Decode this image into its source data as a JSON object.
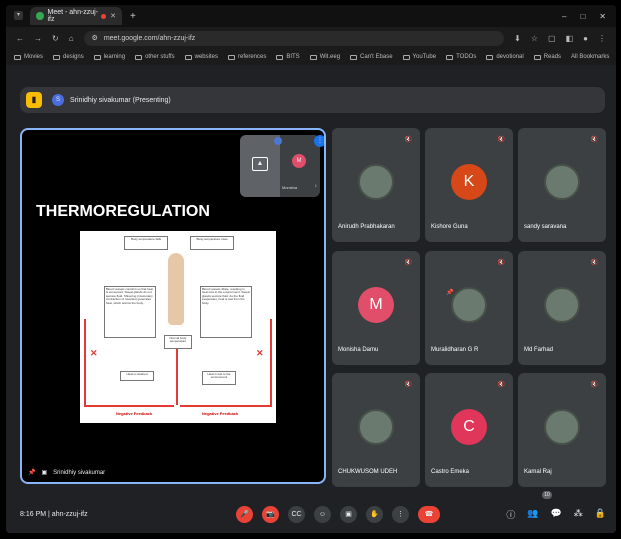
{
  "browser": {
    "tab_title": "Meet - ahn-zzuj-ifz",
    "url": "meet.google.com/ahn-zzuj-ifz",
    "bookmarks": [
      "Movies",
      "designs",
      "learning",
      "other stuffs",
      "websites",
      "references",
      "BITS",
      "Wit.eeg",
      "Can't Ebase",
      "YouTube",
      "TODOs",
      "devotional",
      "Reads"
    ],
    "all_bookmarks": "All Bookmarks"
  },
  "presenting": {
    "avatar": "S",
    "label": "Srinidhiy sivakumar (Presenting)"
  },
  "stage": {
    "slide_title": "THERMOREGULATION",
    "presenter": "Srinidhiy sivakumar",
    "pip_name": "Monisha",
    "pip_avatar": "M",
    "diagram": {
      "top_left": "Body temperature falls",
      "top_right": "Body temperature rises",
      "left": "Blood vessels constrict so that heat is conserved. Sweat glands do not secrete fluid. Shivering (involuntary contraction of muscles) generates heat, which warms the body.",
      "right": "Blood vessels dilate, resulting in heat loss to the environment. Sweat glands secrete fluid. As the fluid evaporates, heat is lost from the body.",
      "center": "Normal body temperature",
      "bottom_left": "Heat is retained",
      "bottom_right": "Heat is lost to the environment",
      "fb_left": "Negative Feedback",
      "fb_right": "Negative Feedback"
    }
  },
  "participants": [
    {
      "name": "Anirudh Prabhakaran",
      "type": "photo"
    },
    {
      "name": "Kishore Guna",
      "type": "letter",
      "letter": "K",
      "color": "#d64818"
    },
    {
      "name": "sandy saravana",
      "type": "photo"
    },
    {
      "name": "Monisha Damu",
      "type": "letter",
      "letter": "M",
      "color": "#e04e6a"
    },
    {
      "name": "Muralidharan G R",
      "type": "photo"
    },
    {
      "name": "Md Farhad",
      "type": "photo"
    },
    {
      "name": "CHUKWUSOM UDEH",
      "type": "photo"
    },
    {
      "name": "Castro Emeka",
      "type": "letter",
      "letter": "C",
      "color": "#e0365a"
    },
    {
      "name": "Kamal Raj",
      "type": "photo"
    }
  ],
  "bottom": {
    "time": "8:16 PM",
    "code": "ahn-zzuj-ifz",
    "participant_count": "10"
  }
}
